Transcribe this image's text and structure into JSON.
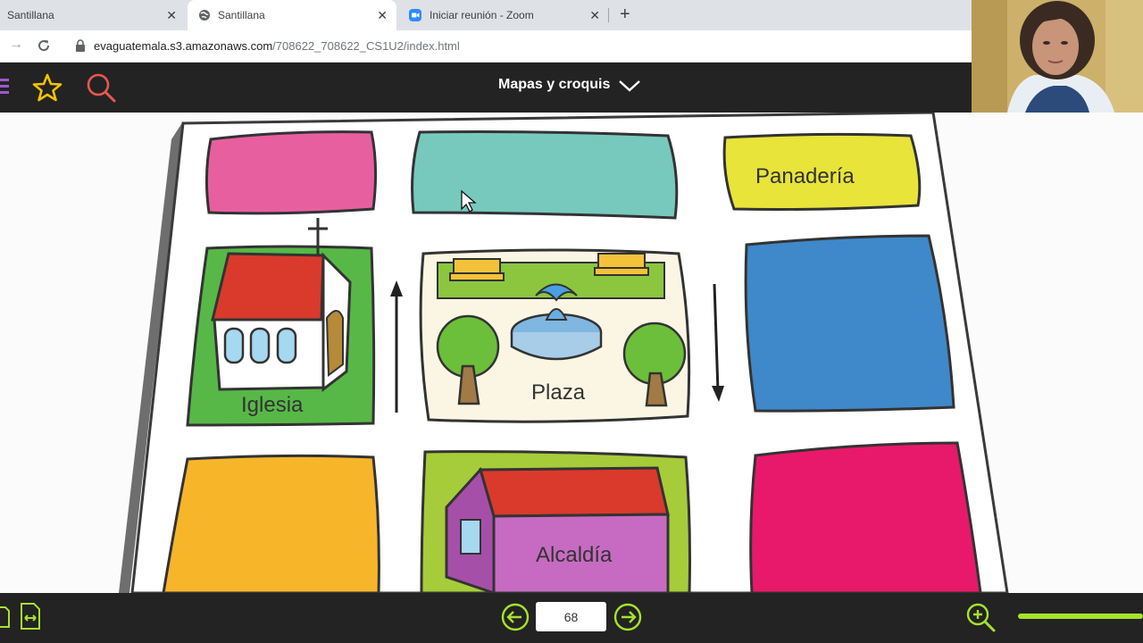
{
  "browser": {
    "tabs": [
      {
        "title": "Santillana",
        "active": false
      },
      {
        "title": "Santillana",
        "active": true
      },
      {
        "title": "Iniciar reunión - Zoom",
        "active": false
      }
    ],
    "url_host": "evaguatemala.s3.amazonaws.com",
    "url_path": "/708622_708622_CS1U2/index.html"
  },
  "app": {
    "section_title": "Mapas y croquis",
    "page_number": "68",
    "accent_color": "#f2c400",
    "search_color": "#e8584f",
    "nav_color": "#a6e22e"
  },
  "map": {
    "labels": {
      "bakery": "Panadería",
      "church": "Iglesia",
      "plaza": "Plaza",
      "city_hall": "Alcaldía"
    },
    "block_colors": {
      "pink": "#e85fa0",
      "teal": "#76c9bc",
      "yellow": "#e8e43a",
      "blue": "#3f88c9",
      "orange": "#f7b52a",
      "magenta": "#e8196a",
      "green": "#57b847",
      "lime": "#a6cc3a"
    }
  }
}
